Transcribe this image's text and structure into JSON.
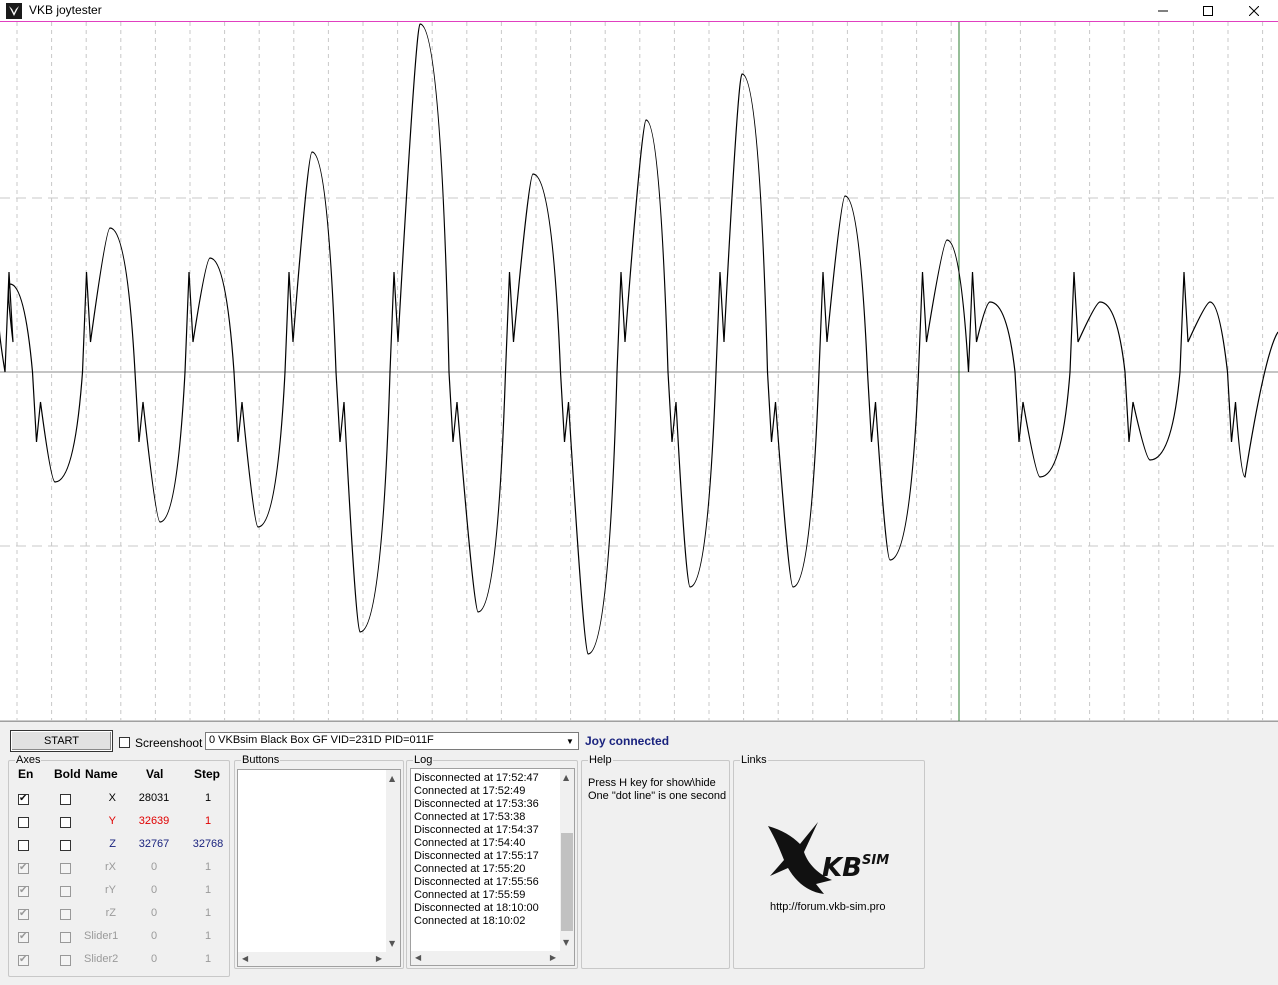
{
  "window": {
    "title": "VKB joytester"
  },
  "toolbar": {
    "start_label": "START",
    "screenshot_label": "Screenshoot",
    "screenshot_checked": false,
    "device_value": "0 VKBsim Black Box GF  VID=231D PID=011F",
    "status": "Joy connected"
  },
  "axes": {
    "title": "Axes",
    "headers": {
      "en": "En",
      "bold": "Bold",
      "name": "Name",
      "val": "Val",
      "step": "Step"
    },
    "rows": [
      {
        "en": true,
        "bold": false,
        "name": "X",
        "val": "28031",
        "step": "1",
        "color": "#000000",
        "enabled": true
      },
      {
        "en": false,
        "bold": false,
        "name": "Y",
        "val": "32639",
        "step": "1",
        "color": "#e00000",
        "enabled": true
      },
      {
        "en": false,
        "bold": false,
        "name": "Z",
        "val": "32767",
        "step": "32768",
        "color": "#1a237e",
        "enabled": true
      },
      {
        "en": true,
        "bold": false,
        "name": "rX",
        "val": "0",
        "step": "1",
        "color": "#9a9a9a",
        "enabled": false
      },
      {
        "en": true,
        "bold": false,
        "name": "rY",
        "val": "0",
        "step": "1",
        "color": "#9a9a9a",
        "enabled": false
      },
      {
        "en": true,
        "bold": false,
        "name": "rZ",
        "val": "0",
        "step": "1",
        "color": "#9a9a9a",
        "enabled": false
      },
      {
        "en": true,
        "bold": false,
        "name": "Slider1",
        "val": "0",
        "step": "1",
        "color": "#9a9a9a",
        "enabled": false
      },
      {
        "en": true,
        "bold": false,
        "name": "Slider2",
        "val": "0",
        "step": "1",
        "color": "#9a9a9a",
        "enabled": false
      }
    ]
  },
  "buttons_group": {
    "title": "Buttons"
  },
  "log": {
    "title": "Log",
    "lines": [
      "Disconnected at 17:52:47",
      "Connected at 17:52:49",
      "Disconnected at 17:53:36",
      "Connected at 17:53:38",
      "Disconnected at 17:54:37",
      "Connected at 17:54:40",
      "Disconnected at 17:55:17",
      "Connected at 17:55:20",
      "Disconnected at 17:55:56",
      "Connected at 17:55:59",
      "Disconnected at 18:10:00",
      "Connected at 18:10:02"
    ]
  },
  "help": {
    "title": "Help",
    "lines": [
      "Press H key for show\\hide",
      "One \"dot line\" is one second"
    ]
  },
  "links": {
    "title": "Links",
    "logo_text": "VKBSIM",
    "url": "http://forum.vkb-sim.pro"
  },
  "plot": {
    "cursor_color": "#2e7d32",
    "grid_color": "#c8c8c8",
    "signal_color": "#000000"
  }
}
